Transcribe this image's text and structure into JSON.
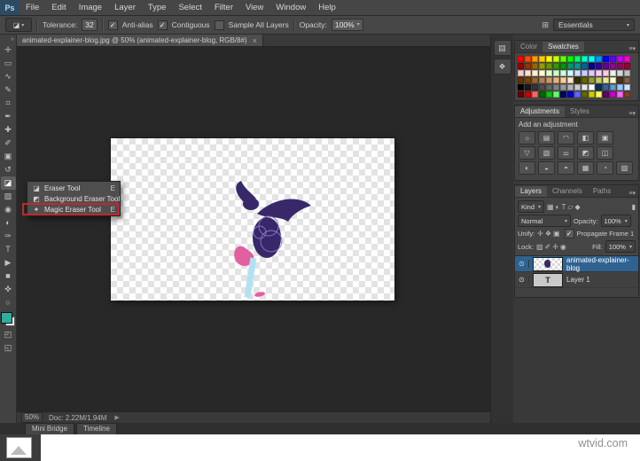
{
  "app": {
    "logo": "Ps"
  },
  "menubar": {
    "items": [
      "File",
      "Edit",
      "Image",
      "Layer",
      "Type",
      "Select",
      "Filter",
      "View",
      "Window",
      "Help"
    ]
  },
  "options": {
    "tool_glyph": "◪",
    "tolerance_label": "Tolerance:",
    "tolerance_value": "32",
    "antialias_label": "Anti-alias",
    "antialias_checked": true,
    "contiguous_label": "Contiguous",
    "contiguous_checked": true,
    "sample_label": "Sample All Layers",
    "sample_checked": false,
    "opacity_label": "Opacity:",
    "opacity_value": "100%",
    "workspace": "Essentials"
  },
  "doc_tab": {
    "title": "animated-explainer-blog.jpg @ 50% (animated-explainer-blog, RGB/8#)",
    "close": "×"
  },
  "toolbar": {
    "tools": [
      {
        "name": "move",
        "glyph": "✛",
        "active": false
      },
      {
        "name": "marquee",
        "glyph": "▭",
        "active": false
      },
      {
        "name": "lasso",
        "glyph": "∿",
        "active": false
      },
      {
        "name": "quick-selection",
        "glyph": "✎",
        "active": false
      },
      {
        "name": "crop",
        "glyph": "⌗",
        "active": false
      },
      {
        "name": "eyedropper",
        "glyph": "✒",
        "active": false
      },
      {
        "name": "healing-brush",
        "glyph": "✚",
        "active": false
      },
      {
        "name": "brush",
        "glyph": "✐",
        "active": false
      },
      {
        "name": "clone-stamp",
        "glyph": "▣",
        "active": false
      },
      {
        "name": "history-brush",
        "glyph": "↺",
        "active": false
      },
      {
        "name": "eraser",
        "glyph": "◪",
        "active": true
      },
      {
        "name": "gradient",
        "glyph": "▨",
        "active": false
      },
      {
        "name": "blur",
        "glyph": "◉",
        "active": false
      },
      {
        "name": "dodge",
        "glyph": "◐",
        "active": false
      },
      {
        "name": "pen",
        "glyph": "✑",
        "active": false
      },
      {
        "name": "type",
        "glyph": "T",
        "active": false
      },
      {
        "name": "path-selection",
        "glyph": "▶",
        "active": false
      },
      {
        "name": "shape",
        "glyph": "■",
        "active": false
      },
      {
        "name": "hand",
        "glyph": "✜",
        "active": false
      },
      {
        "name": "zoom",
        "glyph": "○",
        "active": false
      },
      {
        "name": "quick-mask",
        "glyph": "◰",
        "active": false
      },
      {
        "name": "screen-mode",
        "glyph": "◱",
        "active": false
      }
    ]
  },
  "flyout": {
    "items": [
      {
        "icon": "◪",
        "label": "Eraser Tool",
        "shortcut": "E",
        "highlighted": false
      },
      {
        "icon": "◩",
        "label": "Background Eraser Tool",
        "shortcut": "E",
        "highlighted": false
      },
      {
        "icon": "✦",
        "label": "Magic Eraser Tool",
        "shortcut": "E",
        "highlighted": true
      }
    ]
  },
  "dock_strip": {
    "icons": [
      {
        "name": "history-panel",
        "glyph": "▤"
      },
      {
        "name": "properties-panel",
        "glyph": "❖"
      }
    ]
  },
  "panels": {
    "color": {
      "tabs": [
        "Color",
        "Swatches"
      ],
      "active_tab": "Swatches",
      "menu_icon": "≡",
      "swatches": [
        "#ff0000",
        "#ff4d00",
        "#ff9900",
        "#ffcc00",
        "#ffff00",
        "#ccff00",
        "#66ff00",
        "#00ff00",
        "#00ff66",
        "#00ffcc",
        "#00ffff",
        "#0099ff",
        "#0000ff",
        "#6600ff",
        "#cc00ff",
        "#ff00cc",
        "#990000",
        "#993300",
        "#996600",
        "#999900",
        "#669900",
        "#339900",
        "#009900",
        "#009966",
        "#009999",
        "#006699",
        "#000099",
        "#330099",
        "#660099",
        "#990099",
        "#990066",
        "#990033",
        "#ffcccc",
        "#ffe0cc",
        "#fff0cc",
        "#ffffcc",
        "#e0ffcc",
        "#ccffcc",
        "#ccffe0",
        "#ccffff",
        "#cce0ff",
        "#ccccff",
        "#e0ccff",
        "#ffccff",
        "#ffcce0",
        "#f0f0f0",
        "#d8d8d8",
        "#c0c0c0",
        "#663300",
        "#804000",
        "#996633",
        "#b38059",
        "#cc9966",
        "#e6b380",
        "#ffcc99",
        "#ffe6cc",
        "#333300",
        "#666600",
        "#999933",
        "#cccc66",
        "#e6e699",
        "#ffffcc",
        "#4d331a",
        "#806040",
        "#000000",
        "#1a1a1a",
        "#333333",
        "#4d4d4d",
        "#666666",
        "#808080",
        "#999999",
        "#b3b3b3",
        "#cccccc",
        "#e6e6e6",
        "#ffffff",
        "#003366",
        "#336699",
        "#6699cc",
        "#99ccff",
        "#cce6ff",
        "#660000",
        "#cc0000",
        "#ff6666",
        "#006600",
        "#00cc00",
        "#66ff66",
        "#000066",
        "#0000cc",
        "#6666ff",
        "#666600",
        "#cccc00",
        "#ffff66",
        "#660066",
        "#cc00cc",
        "#ff66ff",
        "#804020"
      ]
    },
    "adjustments": {
      "tabs": [
        "Adjustments",
        "Styles"
      ],
      "active_tab": "Adjustments",
      "heading": "Add an adjustment",
      "icon_rows": [
        [
          "☼",
          "▤",
          "◠",
          "◧",
          "▣"
        ],
        [
          "▽",
          "▧",
          "⚌",
          "◩",
          "◫"
        ],
        [
          "◐",
          "◒",
          "◓",
          "▦",
          "◔",
          "▨"
        ]
      ]
    },
    "layers": {
      "tabs": [
        "Layers",
        "Channels",
        "Paths"
      ],
      "active_tab": "Layers",
      "kind_label": "Kind",
      "filter_icons": [
        "▦",
        "◐",
        "T",
        "▱",
        "◆"
      ],
      "blend_mode": "Normal",
      "opacity_label": "Opacity:",
      "opacity_value": "100%",
      "unify_label": "Unify:",
      "unify_icons": [
        "✛",
        "❖",
        "▣"
      ],
      "propagate_checked": true,
      "propagate_label": "Propagate Frame 1",
      "lock_label": "Lock:",
      "lock_icons": [
        "▨",
        "✐",
        "✛",
        "◉"
      ],
      "fill_label": "Fill:",
      "fill_value": "100%",
      "rows": [
        {
          "name": "animated-explainer-blog",
          "type": "image",
          "selected": true,
          "visible": true
        },
        {
          "name": "Layer 1",
          "type": "text",
          "selected": false,
          "visible": true
        }
      ]
    }
  },
  "statusbar": {
    "zoom": "50%",
    "doc": "Doc: 2.22M/1.94M"
  },
  "bottom_tabs": [
    "Mini Bridge",
    "Timeline"
  ],
  "watermark": "wtvid.com",
  "colors": {
    "selection_blue": "#2e6290",
    "annotation_red": "#c1272d",
    "foreground_chip": "#2fae9d",
    "artwork_purple": "#38286a",
    "artwork_pink": "#e2609f",
    "artwork_blue": "#b3e1f4"
  }
}
